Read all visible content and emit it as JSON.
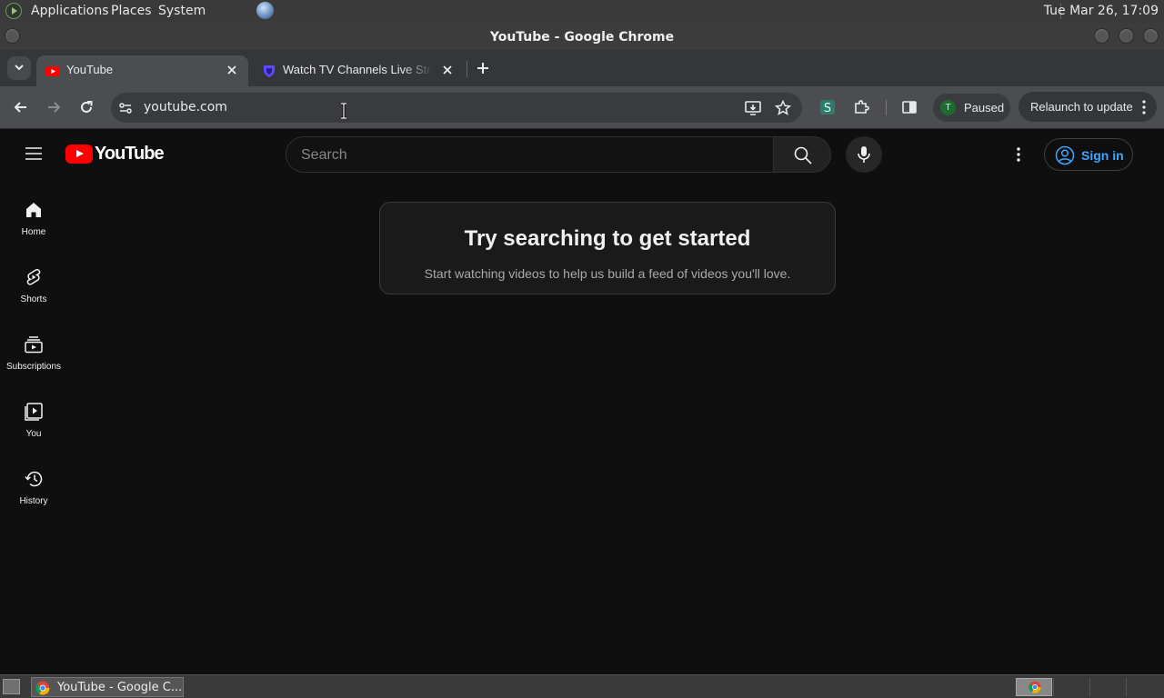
{
  "os_panel": {
    "menus": [
      "Applications",
      "Places",
      "System"
    ],
    "clock": "Tue Mar 26, 17:09"
  },
  "window": {
    "title": "YouTube - Google Chrome"
  },
  "tabs": [
    {
      "title": "YouTube",
      "favicon": "youtube-favicon",
      "active": true
    },
    {
      "title": "Watch TV Channels Live Stre",
      "favicon": "shield-favicon",
      "active": false
    }
  ],
  "toolbar": {
    "url": "youtube.com",
    "profile_initial": "T",
    "profile_status": "Paused",
    "relaunch_label": "Relaunch to update"
  },
  "youtube": {
    "logo_text": "YouTube",
    "search_placeholder": "Search",
    "sign_in": "Sign in",
    "guide": [
      {
        "label": "Home",
        "icon": "home-icon"
      },
      {
        "label": "Shorts",
        "icon": "shorts-icon"
      },
      {
        "label": "Subscriptions",
        "icon": "subscriptions-icon"
      },
      {
        "label": "You",
        "icon": "you-icon"
      },
      {
        "label": "History",
        "icon": "history-icon"
      }
    ],
    "empty_state": {
      "title": "Try searching to get started",
      "subtitle": "Start watching videos to help us build a feed of videos you'll love."
    }
  },
  "taskbar": {
    "window_button": "YouTube - Google C..."
  },
  "colors": {
    "youtube_red": "#ff0000",
    "link_blue": "#3ea6ff",
    "page_bg": "#0f0f0f"
  }
}
